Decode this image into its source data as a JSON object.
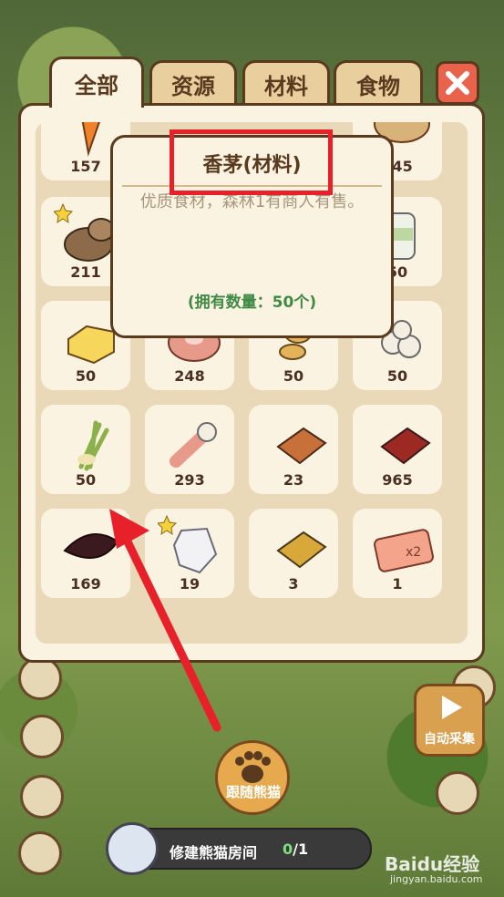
{
  "tabs": [
    {
      "label": "全部",
      "active": true
    },
    {
      "label": "资源",
      "active": false
    },
    {
      "label": "材料",
      "active": false
    },
    {
      "label": "食物",
      "active": false
    }
  ],
  "close_icon": "close-x-icon",
  "items": [
    {
      "name": "carrot",
      "count": "157"
    },
    {
      "name": "hidden",
      "count": ""
    },
    {
      "name": "hidden",
      "count": ""
    },
    {
      "name": "potato",
      "count": "245"
    },
    {
      "name": "taro",
      "count": "211",
      "star": true
    },
    {
      "name": "hidden",
      "count": ""
    },
    {
      "name": "hidden",
      "count": ""
    },
    {
      "name": "milk-jar",
      "count": "50"
    },
    {
      "name": "butter",
      "count": "50"
    },
    {
      "name": "meat",
      "count": "248"
    },
    {
      "name": "ginger",
      "count": "50"
    },
    {
      "name": "garlic",
      "count": "50"
    },
    {
      "name": "lemongrass",
      "count": "50"
    },
    {
      "name": "leg-meat",
      "count": "293"
    },
    {
      "name": "wood-plank",
      "count": "23"
    },
    {
      "name": "red-brick",
      "count": "965"
    },
    {
      "name": "dark-leaf",
      "count": "169"
    },
    {
      "name": "crystal",
      "count": "19",
      "star": true
    },
    {
      "name": "gold-bar",
      "count": "3"
    },
    {
      "name": "ticket-x2",
      "count": "1"
    }
  ],
  "tooltip": {
    "title": "香茅(材料)",
    "description": "优质食材，森林1有商人有售。",
    "quantity": "(拥有数量：50个)"
  },
  "bottom": {
    "paw_button_label": "跟随熊猫",
    "auto_button_label": "自动采集",
    "task_label": "修建熊猫房间",
    "task_done": "0",
    "task_total": "/1"
  },
  "watermark": {
    "text": "Baidu经验",
    "url": "jingyan.baidu.com"
  },
  "colors": {
    "tab_border": "#5a3a1e",
    "highlight": "#e8202a",
    "arrow": "#e8202a",
    "quantity": "#3f8a45"
  }
}
